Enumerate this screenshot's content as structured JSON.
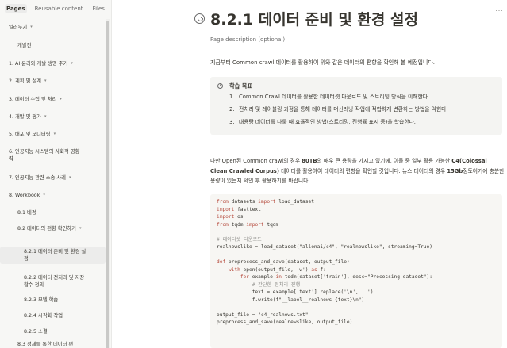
{
  "sidebar": {
    "tabs": [
      {
        "label": "Pages",
        "active": true
      },
      {
        "label": "Reusable content",
        "active": false
      },
      {
        "label": "Files",
        "active": false
      }
    ],
    "items": [
      {
        "label": "일러두기",
        "caret": true,
        "indent": 0
      },
      {
        "label": "개발진",
        "caret": false,
        "indent": 1
      },
      {
        "label": "1. AI 윤리와 개발 생명 주기",
        "caret": true,
        "indent": 0
      },
      {
        "label": "2. 계획 및 설계",
        "caret": true,
        "indent": 0
      },
      {
        "label": "3. 데이터 수집 및 처리",
        "caret": true,
        "indent": 0
      },
      {
        "label": "4. 개발 및 평가",
        "caret": true,
        "indent": 0
      },
      {
        "label": "5. 배포 및 모니터링",
        "caret": true,
        "indent": 0
      },
      {
        "label": "6. 인공지능 시스템의 사회적 영향",
        "label2": "력",
        "caret": false,
        "indent": 0
      },
      {
        "label": "7. 인공지능 관련 소송 사례",
        "caret": true,
        "indent": 0
      },
      {
        "label": "8. Workbook",
        "caret": true,
        "indent": 0
      },
      {
        "label": "8.1 배경",
        "caret": false,
        "indent": 1
      },
      {
        "label": "8.2 데이터의 편향 확인하기",
        "caret": true,
        "indent": 1
      },
      {
        "label": "8.2.1 데이터 준비 및 환경 설",
        "label2": "정",
        "caret": false,
        "indent": 2,
        "selected": true
      },
      {
        "label": "8.2.2 데이터 전처리 및 저장",
        "label2": "함수 정의",
        "caret": false,
        "indent": 2
      },
      {
        "label": "8.2.3 모델 학습",
        "caret": false,
        "indent": 2
      },
      {
        "label": "8.2.4 시각화 작업",
        "caret": false,
        "indent": 2
      },
      {
        "label": "8.2.5 소결",
        "caret": false,
        "indent": 2
      },
      {
        "label": "8.3 정제를 통한 데이터 편",
        "caret": false,
        "indent": 1
      }
    ]
  },
  "page": {
    "more_icon": "…",
    "title": "8.2.1 데이터 준비 및 환경 설정",
    "description": "Page description (optional)",
    "intro": "지금부터 Common crawl 데이터를 활용하여 위와 같은 데이터의 편향을 확인해 볼 예정입니다.",
    "callout": {
      "icon": "info-icon",
      "title": "학습 목표",
      "items": [
        "Common Crawl 데이터를 활용한 데이터셋 다운로드 및 스트리밍 방식을 이해한다.",
        "전처리 및 레이블링 과정을 통해 데이터를 머신러닝 작업에 적합하게 변환하는 방법을 익힌다.",
        "대용량 데이터를 다룰 때 효율적인 방법(스트리밍, 진행률 표시 등)을 학습한다."
      ]
    },
    "paragraph": {
      "p1": "다만 Open된 Common crawl의 경우 ",
      "b1": "80TB",
      "p2": "의 매우 큰 용량을 가지고 있기에, 이들 중 일부 활용 가능한 ",
      "b2": "C4(Colossal Clean Crawled Corpus)",
      "p3": " 데이터를 활용하여 데이터의 편향을 확인할 것입니다. 뉴스 데이터의 경우 ",
      "b3": "15Gb",
      "p4": "정도이기에 충분한 용량이 있는지 확인 후 활용하기를 바랍니다."
    },
    "code_lines": [
      "from datasets import load_dataset",
      "import fasttext",
      "import os",
      "from tqdm import tqdm",
      "",
      "# 데이터셋 다운로드",
      "realnewslike = load_dataset(\"allenai/c4\", \"realnewslike\", streaming=True)",
      "",
      "def preprocess_and_save(dataset, output_file):",
      "    with open(output_file, 'w') as f:",
      "        for example in tqdm(dataset['train'], desc=\"Processing dataset\"):",
      "            # 간단한 전처리 진행",
      "            text = example['text'].replace('\\n', ' ')",
      "            f.write(f\"__label__realnews {text}\\n\")",
      "",
      "output_file = \"c4_realnews.txt\"",
      "preprocess_and_save(realnewslike, output_file)"
    ]
  }
}
